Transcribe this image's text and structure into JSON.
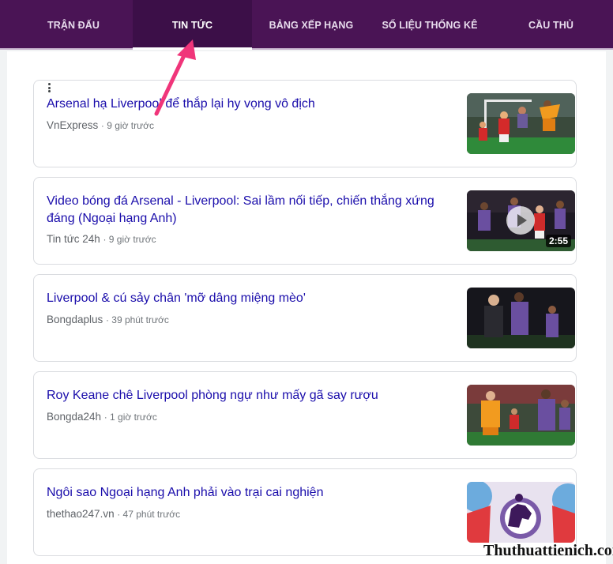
{
  "tabs": [
    {
      "label": "TRẬN ĐẤU"
    },
    {
      "label": "TIN TỨC"
    },
    {
      "label": "BẢNG XẾP HẠNG"
    },
    {
      "label": "SỐ LIỆU THỐNG KÊ"
    },
    {
      "label": "CẦU THỦ"
    }
  ],
  "active_tab": "TIN TỨC",
  "colors": {
    "header_bg": "#4a1455",
    "title_link": "#1a0dab",
    "arrow": "#f0357a"
  },
  "articles": [
    {
      "title": "Arsenal hạ Liverpool để thắp lại hy vọng vô địch",
      "source": "VnExpress",
      "time": "9 giờ trước",
      "thumb": "arsenal-goalkeeper-photo"
    },
    {
      "title": "Video bóng đá Arsenal - Liverpool: Sai lầm nối tiếp, chiến thắng xứng đáng (Ngoại hạng Anh)",
      "source": "Tin tức 24h",
      "time": "9 giờ trước",
      "thumb": "match-video-photo",
      "duration": "2:55"
    },
    {
      "title": "Liverpool & cú sảy chân 'mỡ dâng miệng mèo'",
      "source": "Bongdaplus",
      "time": "39 phút trước",
      "thumb": "liverpool-players-photo"
    },
    {
      "title": "Roy Keane chê Liverpool phòng ngự như mấy gã say rượu",
      "source": "Bongda24h",
      "time": "1 giờ trước",
      "thumb": "raya-penalty-photo"
    },
    {
      "title": "Ngôi sao Ngoại hạng Anh phải vào trại cai nghiện",
      "source": "thethao247.vn",
      "time": "47 phút trước",
      "thumb": "premier-league-logo"
    }
  ],
  "watermark": "Thuthuattienich.com"
}
